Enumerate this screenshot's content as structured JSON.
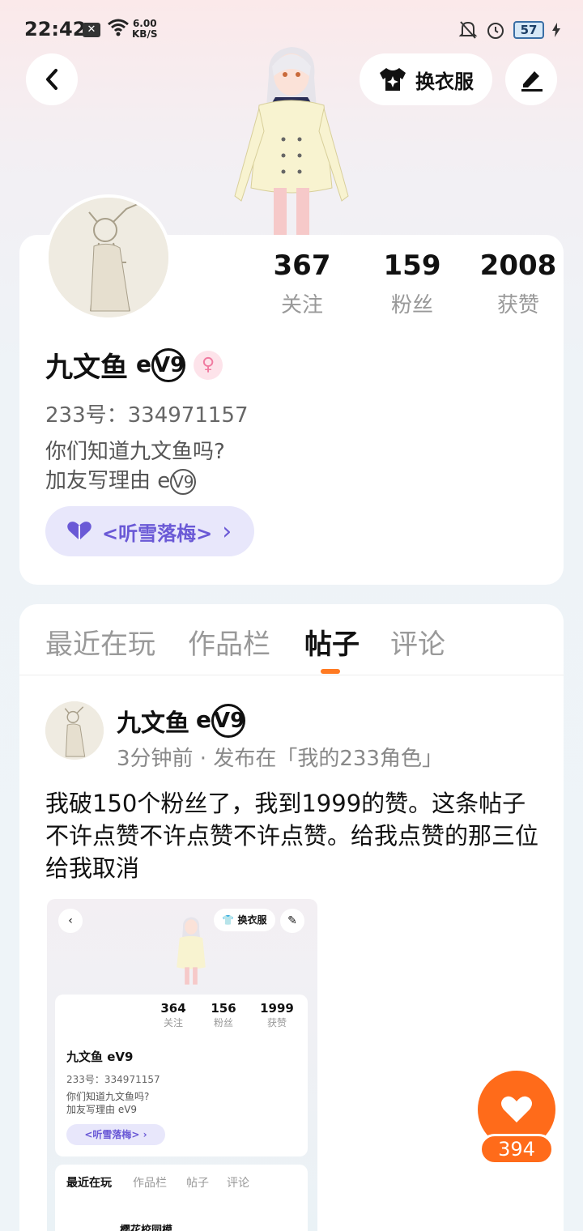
{
  "status_bar": {
    "time": "22:42",
    "speed_value": "6.00",
    "speed_unit": "KB/S",
    "battery": "57"
  },
  "header": {
    "dress_up_label": "换衣服"
  },
  "profile": {
    "stats": [
      {
        "value": "367",
        "label": "关注"
      },
      {
        "value": "159",
        "label": "粉丝"
      },
      {
        "value": "2008",
        "label": "获赞"
      }
    ],
    "name": "九文鱼",
    "name_suffix_e": "e",
    "name_suffix_circle": "V9",
    "gender_symbol": "♀",
    "uid": "233号：334971157",
    "bio_line1": "你们知道九文鱼吗?",
    "bio_line2": "加友写理由 e",
    "bio_circle": "V9",
    "club_label": "<听雪落梅>",
    "club_chevron": "›"
  },
  "tabs": [
    {
      "label": "最近在玩"
    },
    {
      "label": "作品栏"
    },
    {
      "label": "帖子"
    },
    {
      "label": "评论"
    }
  ],
  "post": {
    "author": "九文鱼",
    "author_suffix_e": "e",
    "author_suffix_circle": "V9",
    "meta": "3分钟前 · 发布在「我的233角色」",
    "text": "我破150个粉丝了，我到1999的赞。这条帖子不许点赞不许点赞不许点赞。给我点赞的那三位给我取消",
    "embedded": {
      "dress_up_label": "换衣服",
      "stats": [
        {
          "value": "364",
          "label": "关注"
        },
        {
          "value": "156",
          "label": "粉丝"
        },
        {
          "value": "1999",
          "label": "获赞"
        }
      ],
      "name": "九文鱼",
      "name_suffix": "eV9",
      "uid": "233号：334971157",
      "bio_line1": "你们知道九文鱼吗?",
      "bio_line2": "加友写理由 eV9",
      "club_label": "<听雪落梅> ›",
      "tabs": [
        "最近在玩",
        "作品栏",
        "帖子",
        "评论"
      ],
      "game_name": "樱花校园模"
    }
  },
  "like": {
    "count": "394"
  },
  "colors": {
    "accent": "#ff6b1a",
    "club_text": "#6a59d6",
    "club_bg": "#e8e7fb",
    "gender_pink": "#f07aa0"
  }
}
